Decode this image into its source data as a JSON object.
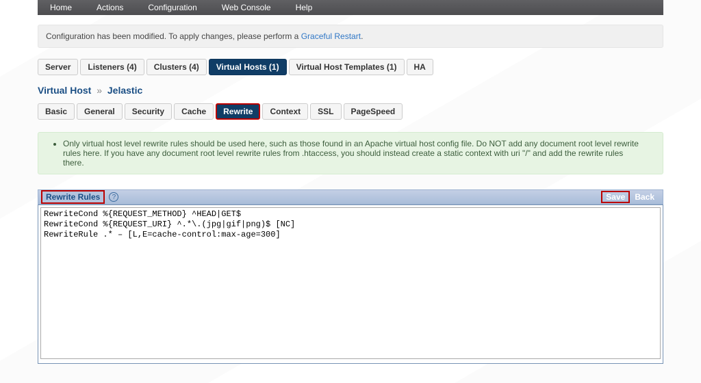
{
  "nav": [
    "Home",
    "Actions",
    "Configuration",
    "Web Console",
    "Help"
  ],
  "notice": {
    "prefix": "Configuration has been modified. To apply changes, please perform a ",
    "link": "Graceful Restart",
    "suffix": "."
  },
  "primaryTabs": [
    {
      "label": "Server",
      "active": false
    },
    {
      "label": "Listeners (4)",
      "active": false
    },
    {
      "label": "Clusters (4)",
      "active": false
    },
    {
      "label": "Virtual Hosts (1)",
      "active": true
    },
    {
      "label": "Virtual Host Templates (1)",
      "active": false
    },
    {
      "label": "HA",
      "active": false
    }
  ],
  "breadcrumb": {
    "a": "Virtual Host",
    "b": "Jelastic"
  },
  "subTabs": [
    {
      "label": "Basic",
      "active": false,
      "hl": false
    },
    {
      "label": "General",
      "active": false,
      "hl": false
    },
    {
      "label": "Security",
      "active": false,
      "hl": false
    },
    {
      "label": "Cache",
      "active": false,
      "hl": false
    },
    {
      "label": "Rewrite",
      "active": true,
      "hl": true
    },
    {
      "label": "Context",
      "active": false,
      "hl": false
    },
    {
      "label": "SSL",
      "active": false,
      "hl": false
    },
    {
      "label": "PageSpeed",
      "active": false,
      "hl": false
    }
  ],
  "info": "Only virtual host level rewrite rules should be used here, such as those found in an Apache virtual host config file. Do NOT add any document root level rewrite rules here. If you have any document root level rewrite rules from .htaccess, you should instead create a static context with uri \"/\" and add the rewrite rules there.",
  "section": {
    "title": "Rewrite Rules",
    "save": "Save",
    "back": "Back"
  },
  "rules": "RewriteCond %{REQUEST_METHOD} ^HEAD|GET$\nRewriteCond %{REQUEST_URI} ^.*\\.(jpg|gif|png)$ [NC]\nRewriteRule .* – [L,E=cache-control:max-age=300]"
}
